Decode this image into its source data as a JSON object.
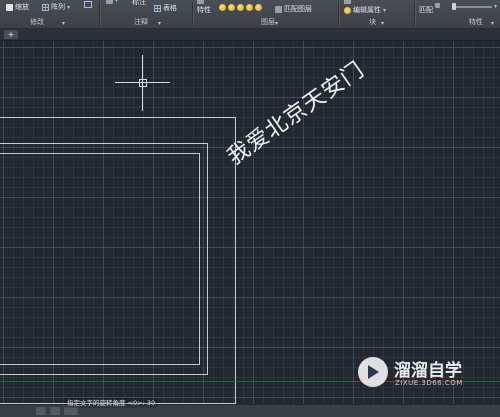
{
  "ribbon": {
    "modify": {
      "scale": "缩放",
      "array": "阵列",
      "title": "修改"
    },
    "annotation": {
      "note": "标注",
      "table": "表格",
      "title": "注释"
    },
    "layers": {
      "props": "特性",
      "match": "匹配图层",
      "title": "图层"
    },
    "block": {
      "edit_attr": "编辑属性",
      "title": "块"
    },
    "properties": {
      "match": "匹配",
      "title": "特性"
    }
  },
  "tabs": {
    "new_tab": "+"
  },
  "drawing": {
    "text": "我爱北京天安门"
  },
  "watermark": {
    "title": "溜溜自学",
    "url": "ZIXUE.3D66.COM"
  },
  "command": {
    "prompt": "指定文字的旋转角度 <0>: 30"
  },
  "colors": {
    "canvas": "#212830",
    "ribbon": "#3b4047",
    "grid": "#505c6a"
  }
}
